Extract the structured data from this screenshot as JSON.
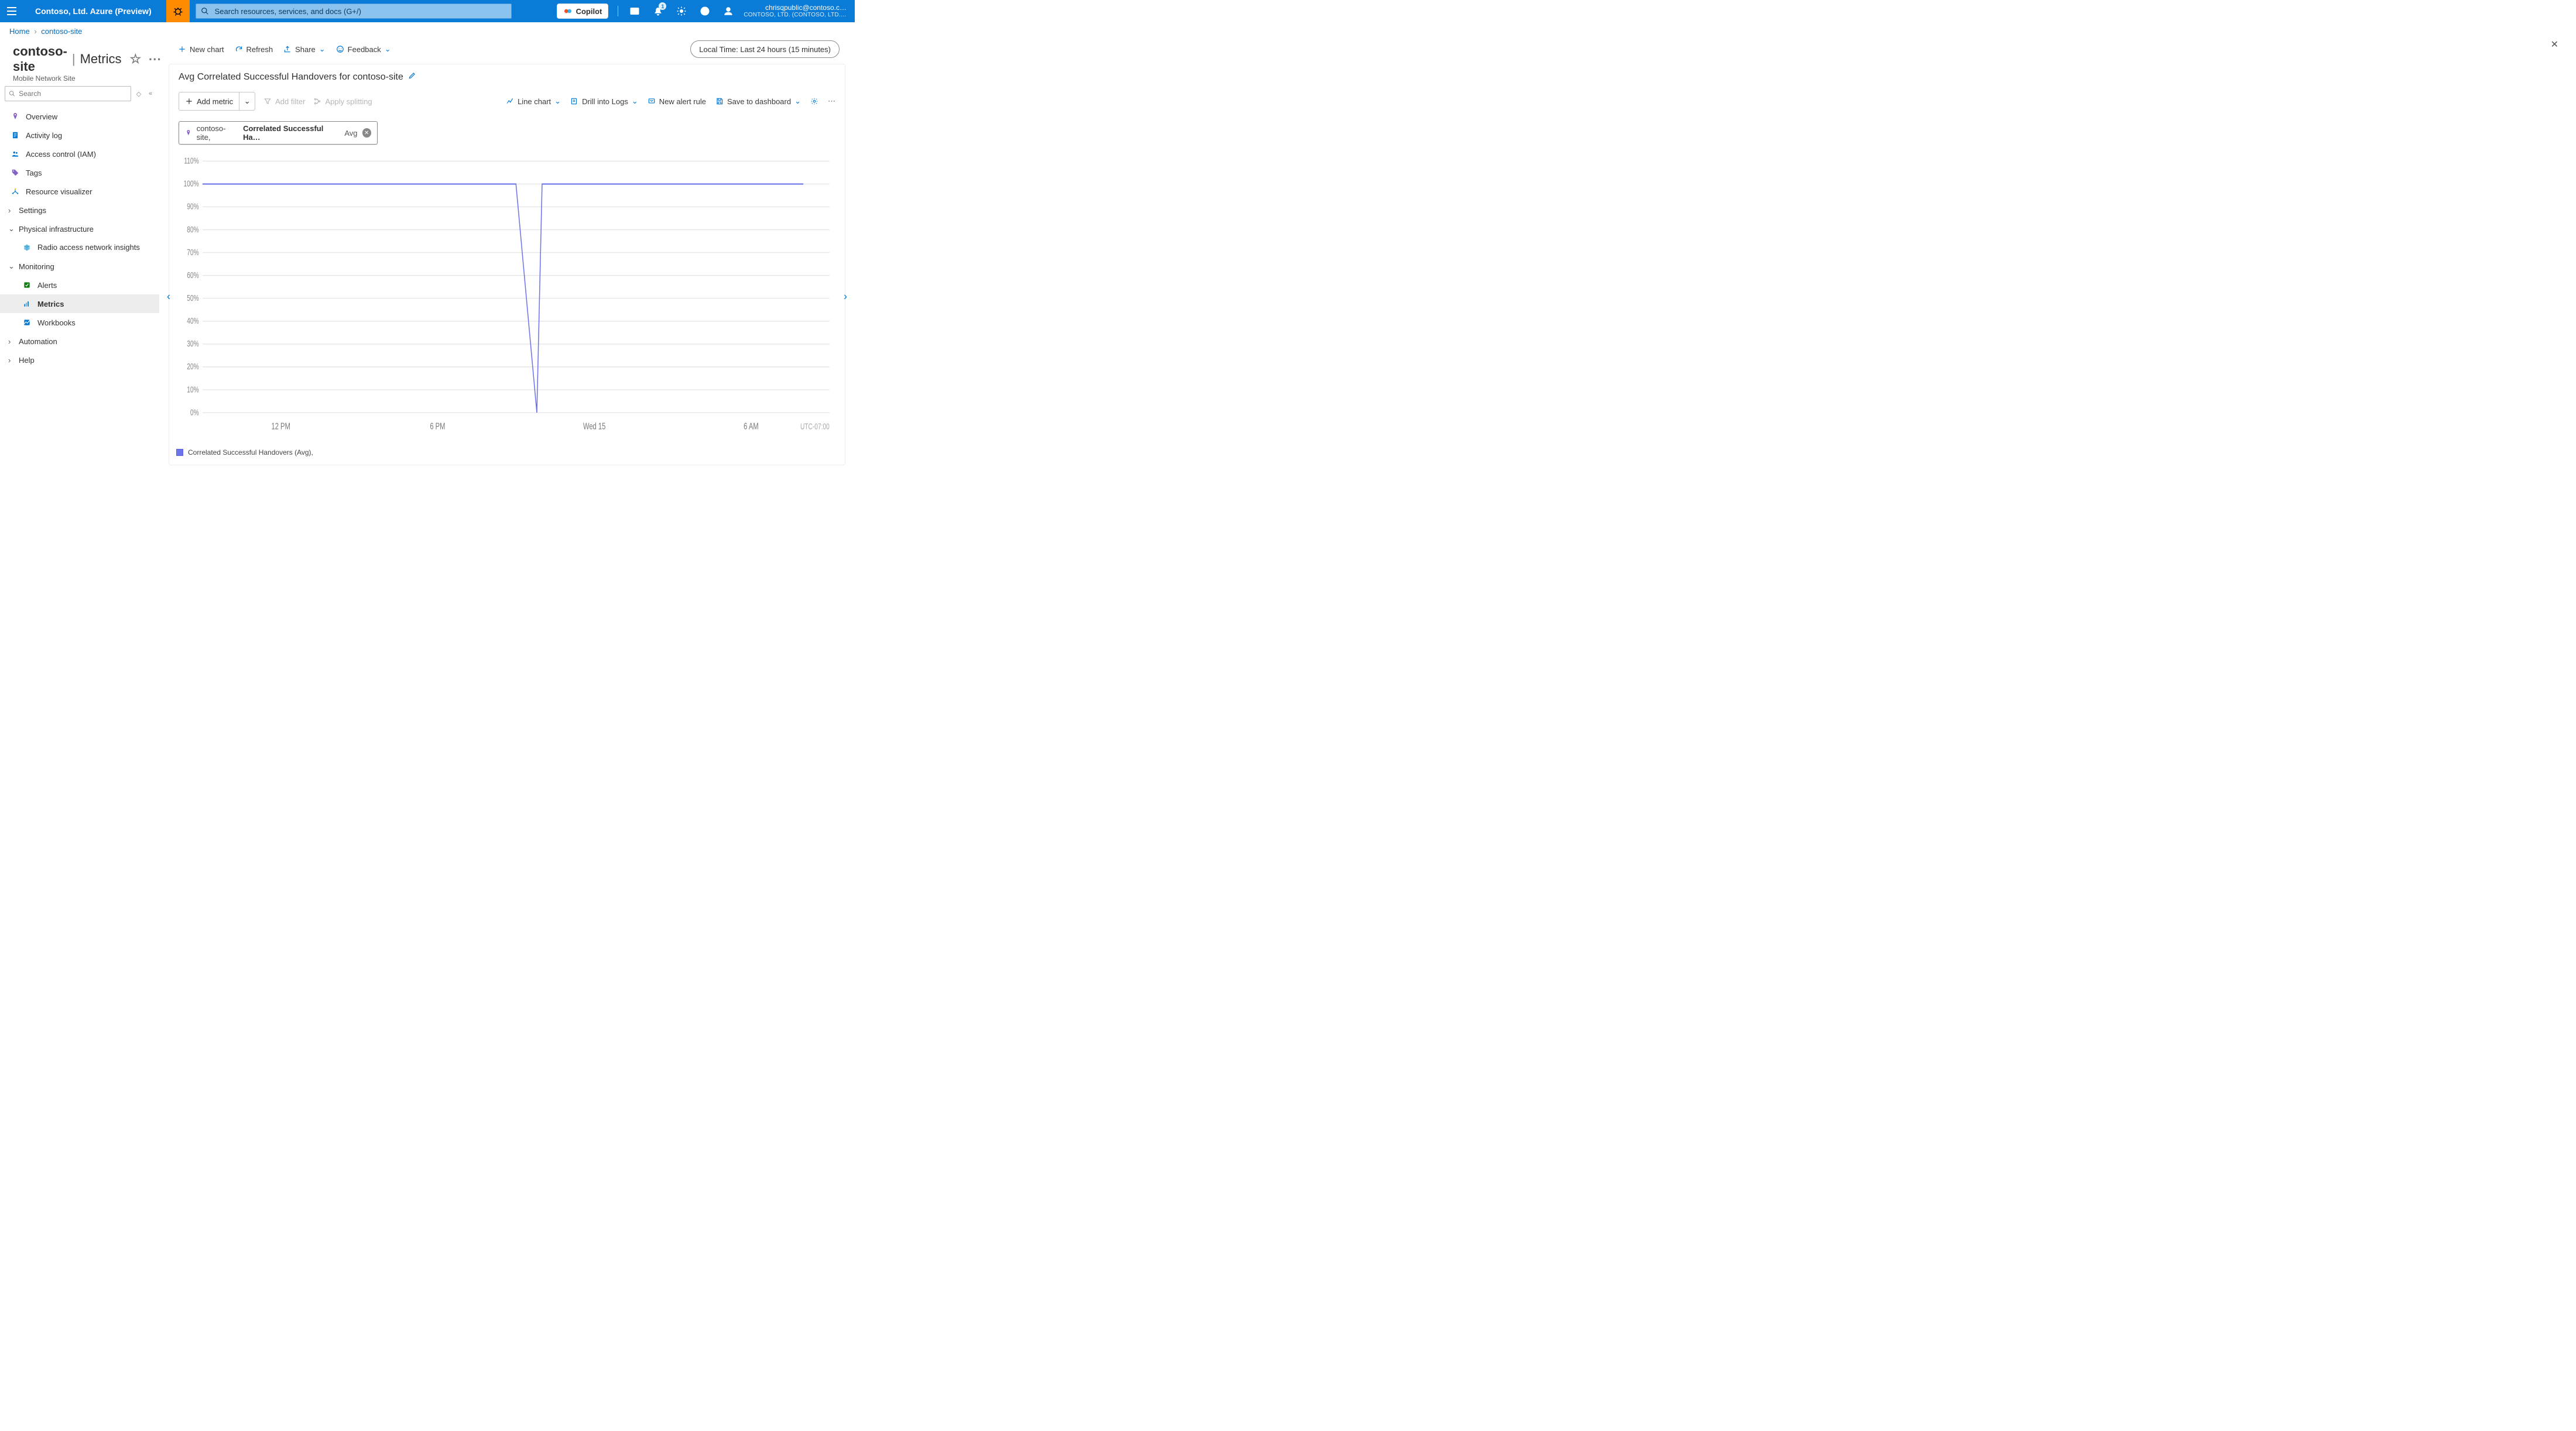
{
  "header": {
    "brand": "Contoso, Ltd. Azure (Preview)",
    "search_placeholder": "Search resources, services, and docs (G+/)",
    "copilot": "Copilot",
    "notifications_badge": "1",
    "user_email": "chrisqpublic@contoso.c…",
    "user_tenant": "CONTOSO, LTD. (CONTOSO, LTD.…"
  },
  "breadcrumb": {
    "home": "Home",
    "current": "contoso-site"
  },
  "title": {
    "resource": "contoso-site",
    "page": "Metrics",
    "subtitle": "Mobile Network Site"
  },
  "search_local_placeholder": "Search",
  "sidebar": {
    "items": [
      {
        "label": "Overview",
        "icon": "pin",
        "color": "#8661c5"
      },
      {
        "label": "Activity log",
        "icon": "log",
        "color": "#0078d4"
      },
      {
        "label": "Access control (IAM)",
        "icon": "people",
        "color": "#0078d4"
      },
      {
        "label": "Tags",
        "icon": "tag",
        "color": "#8661c5"
      },
      {
        "label": "Resource visualizer",
        "icon": "visual",
        "color": "#0078d4"
      }
    ],
    "settings": "Settings",
    "physical_header": "Physical infrastructure",
    "physical_items": [
      {
        "label": "Radio access network insights",
        "icon": "cube"
      }
    ],
    "monitoring_header": "Monitoring",
    "monitoring_items": [
      {
        "label": "Alerts",
        "icon": "alerts",
        "color": "#107c10"
      },
      {
        "label": "Metrics",
        "icon": "metrics",
        "color": "#0078d4",
        "selected": true
      },
      {
        "label": "Workbooks",
        "icon": "workbooks",
        "color": "#0078d4"
      }
    ],
    "automation": "Automation",
    "help": "Help"
  },
  "toolbar": {
    "new_chart": "New chart",
    "refresh": "Refresh",
    "share": "Share",
    "feedback": "Feedback",
    "time": "Local Time: Last 24 hours (15 minutes)"
  },
  "card": {
    "title": "Avg Correlated Successful Handovers for contoso-site",
    "add_metric": "Add metric",
    "add_filter": "Add filter",
    "apply_splitting": "Apply splitting",
    "line_chart": "Line chart",
    "drill_logs": "Drill into Logs",
    "new_alert_rule": "New alert rule",
    "save_dashboard": "Save to dashboard"
  },
  "metric_pill": {
    "scope": "contoso-site,",
    "metric": "Correlated Successful Ha…",
    "agg": "Avg"
  },
  "legend": "Correlated Successful Handovers (Avg),",
  "xaxis_tz": "UTC-07:00",
  "chart_data": {
    "type": "line",
    "title": "Avg Correlated Successful Handovers for contoso-site",
    "ylabel": "%",
    "ylim": [
      0,
      110
    ],
    "yticks": [
      "0%",
      "10%",
      "20%",
      "30%",
      "40%",
      "50%",
      "60%",
      "70%",
      "80%",
      "90%",
      "100%",
      "110%"
    ],
    "xticks": [
      "12 PM",
      "6 PM",
      "Wed 15",
      "6 AM"
    ],
    "series": [
      {
        "name": "Correlated Successful Handovers (Avg)",
        "color": "#6d74ea",
        "x": [
          0,
          1,
          2,
          3,
          4,
          5,
          6,
          7,
          8,
          9,
          10,
          11,
          12,
          12.8,
          13,
          13.3,
          14,
          15,
          16,
          17,
          18,
          19,
          20,
          21,
          22,
          23
        ],
        "y": [
          100,
          100,
          100,
          100,
          100,
          100,
          100,
          100,
          100,
          100,
          100,
          100,
          100,
          0,
          100,
          100,
          100,
          100,
          100,
          100,
          100,
          100,
          100,
          100,
          100,
          100
        ]
      }
    ],
    "x_range": [
      0,
      24
    ]
  }
}
